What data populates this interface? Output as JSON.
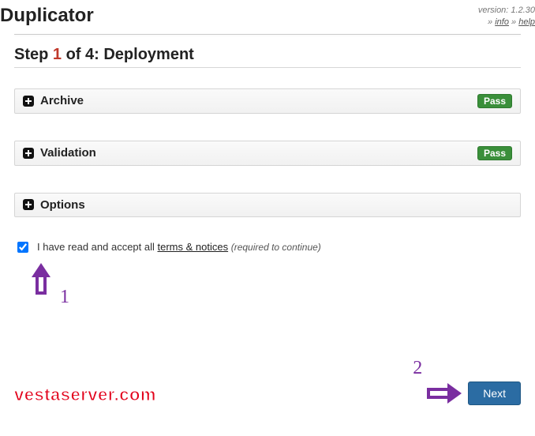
{
  "header": {
    "title": "Duplicator",
    "version_label": "version: 1.2.30",
    "info_link": "info",
    "help_link": "help",
    "sep": "»"
  },
  "step": {
    "prefix": "Step ",
    "number": "1",
    "suffix": " of 4: Deployment"
  },
  "panels": {
    "archive": {
      "title": "Archive",
      "status": "Pass"
    },
    "validation": {
      "title": "Validation",
      "status": "Pass"
    },
    "options": {
      "title": "Options"
    }
  },
  "accept": {
    "checked": true,
    "label_before": "I have read and accept all ",
    "terms_link": "terms & notices",
    "required_text": "(required to continue)"
  },
  "annotations": {
    "num1": "1",
    "num2": "2"
  },
  "footer": {
    "watermark": "vestaserver.com",
    "next_label": "Next"
  }
}
